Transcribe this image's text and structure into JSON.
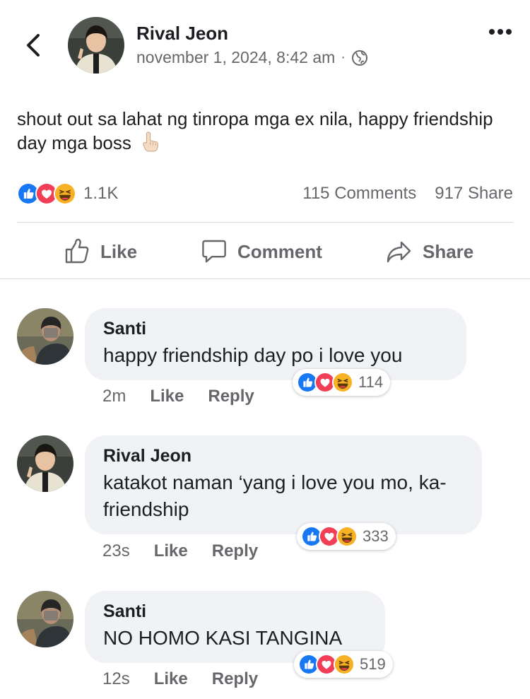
{
  "post": {
    "author": "Rival Jeon",
    "timestamp": "november 1, 2024, 8:42 am",
    "separator": "·",
    "privacy_icon": "globe-icon",
    "text": "shout out sa lahat ng tinropa mga ex nila, happy friendship day mga boss",
    "text_emoji": "pointing-up-emoji",
    "reaction_icons": [
      "like-icon",
      "love-icon",
      "haha-icon"
    ],
    "reaction_count": "1.1K",
    "comments_count": "115 Comments",
    "shares_count": "917 Share"
  },
  "actions": {
    "like": "Like",
    "comment": "Comment",
    "share": "Share"
  },
  "comments": [
    {
      "author": "Santi",
      "text": "happy friendship day po i love you",
      "time": "2m",
      "like": "Like",
      "reply": "Reply",
      "reactions": "114"
    },
    {
      "author": "Rival Jeon",
      "text": "katakot naman ‘yang i love you mo, ka-friendship",
      "time": "23s",
      "like": "Like",
      "reply": "Reply",
      "reactions": "333"
    },
    {
      "author": "Santi",
      "text": "NO HOMO KASI TANGINA",
      "time": "12s",
      "like": "Like",
      "reply": "Reply",
      "reactions": "519"
    }
  ],
  "colors": {
    "like_blue": "#1877f2",
    "love_red": "#f33e58",
    "haha_yellow": "#f7b125",
    "secondary_text": "#65676b",
    "bubble_bg": "#f0f2f5"
  }
}
